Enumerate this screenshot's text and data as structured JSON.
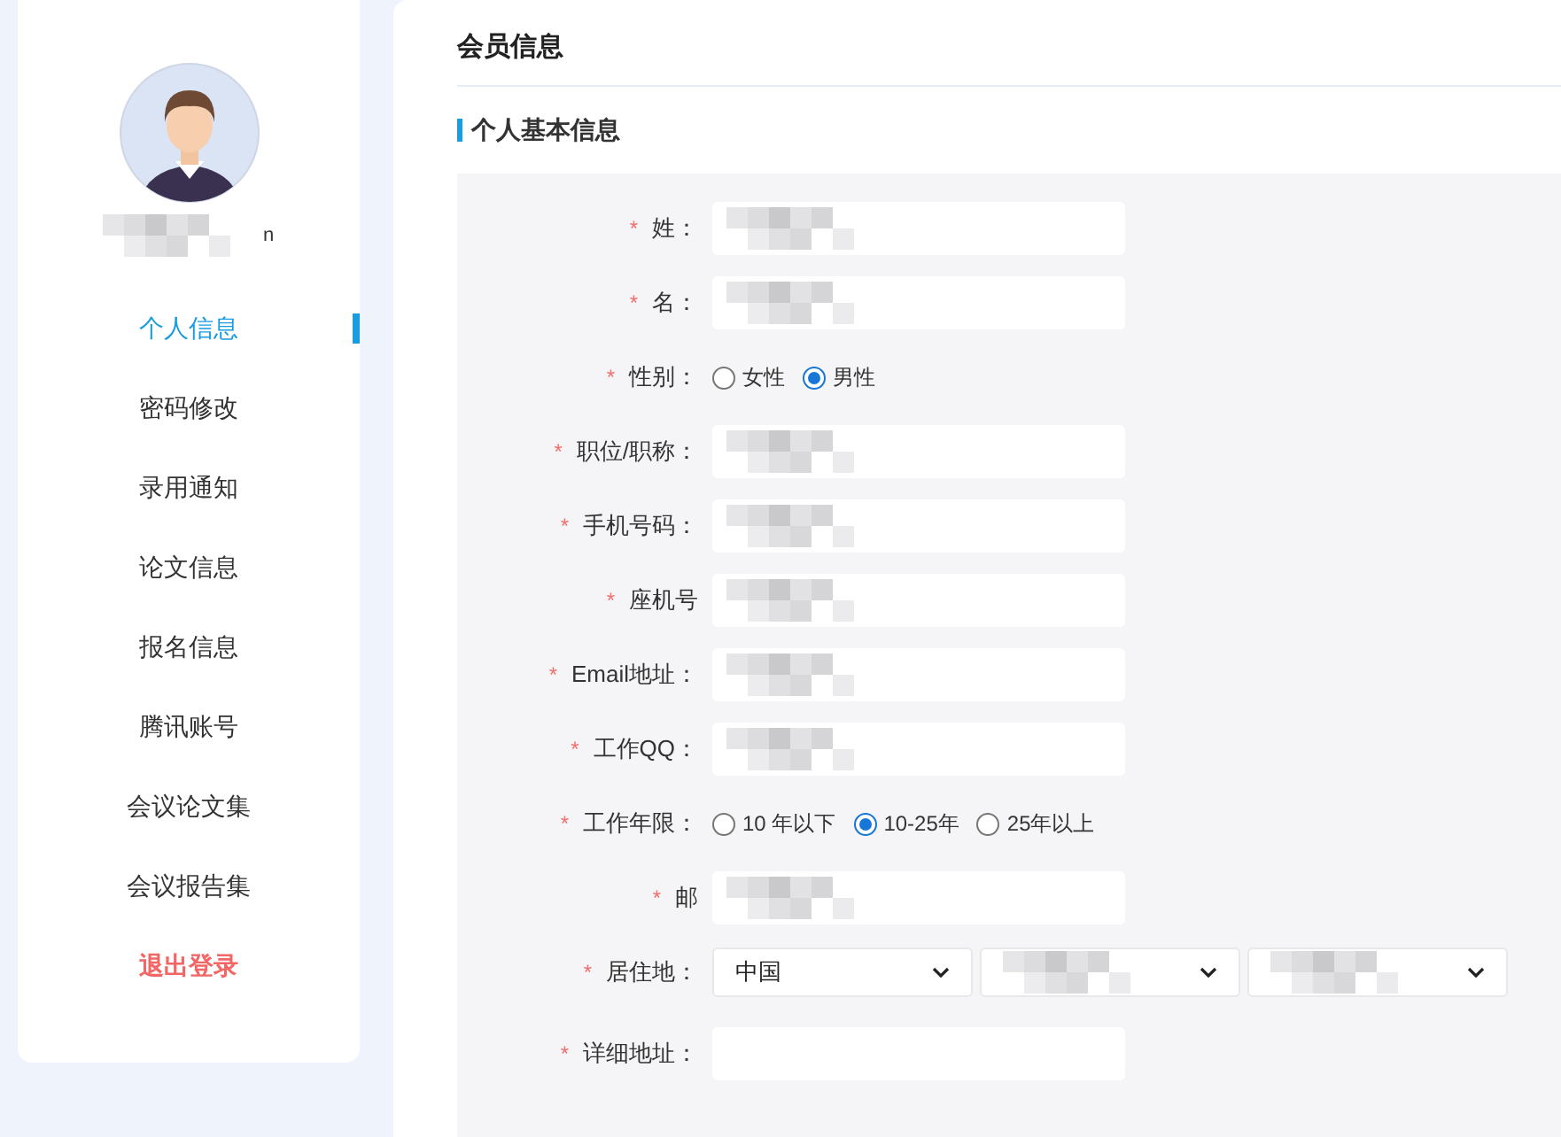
{
  "user": {
    "name_redacted": true,
    "name_tail": "n"
  },
  "sidebar": {
    "items": [
      {
        "label": "个人信息",
        "selected": true,
        "kind": "link"
      },
      {
        "label": "密码修改",
        "selected": false,
        "kind": "link"
      },
      {
        "label": "录用通知",
        "selected": false,
        "kind": "link"
      },
      {
        "label": "论文信息",
        "selected": false,
        "kind": "link"
      },
      {
        "label": "报名信息",
        "selected": false,
        "kind": "link"
      },
      {
        "label": "腾讯账号",
        "selected": false,
        "kind": "link"
      },
      {
        "label": "会议论文集",
        "selected": false,
        "kind": "link"
      },
      {
        "label": "会议报告集",
        "selected": false,
        "kind": "link"
      },
      {
        "label": "退出登录",
        "selected": false,
        "kind": "logout"
      }
    ]
  },
  "page_title": "会员信息",
  "section_title": "个人基本信息",
  "form": [
    {
      "kind": "text",
      "label": "姓：",
      "mark": "*",
      "redacted": true
    },
    {
      "kind": "text",
      "label": "名：",
      "mark": "*",
      "redacted": true
    },
    {
      "kind": "radio",
      "label": "性别：",
      "mark": "*",
      "options": [
        {
          "label": "女性",
          "selected": false
        },
        {
          "label": "男性",
          "selected": true
        }
      ]
    },
    {
      "kind": "text",
      "label": "职位/职称：",
      "mark": "*",
      "redacted": true
    },
    {
      "kind": "text",
      "label": "手机号码：",
      "mark": "*",
      "redacted": true
    },
    {
      "kind": "text",
      "label": "座机号",
      "mark": "*",
      "redacted": true
    },
    {
      "kind": "text",
      "label": "Email地址：",
      "mark": "*",
      "redacted": true
    },
    {
      "kind": "text",
      "label": "工作QQ：",
      "mark": "*",
      "redacted": true
    },
    {
      "kind": "radio",
      "label": "工作年限：",
      "mark": "*",
      "options": [
        {
          "label": "10 年以下",
          "selected": false
        },
        {
          "label": "10-25年",
          "selected": true
        },
        {
          "label": "25年以上",
          "selected": false
        }
      ]
    },
    {
      "kind": "text",
      "label": "邮",
      "mark": "*",
      "redacted": true
    },
    {
      "kind": "selects",
      "label": "居住地：",
      "mark": "*",
      "selects": [
        {
          "value": "中国",
          "redacted": false
        },
        {
          "redacted": true
        },
        {
          "redacted": true
        }
      ]
    },
    {
      "kind": "text",
      "label": "详细地址：",
      "mark": "*",
      "redacted": false
    }
  ]
}
